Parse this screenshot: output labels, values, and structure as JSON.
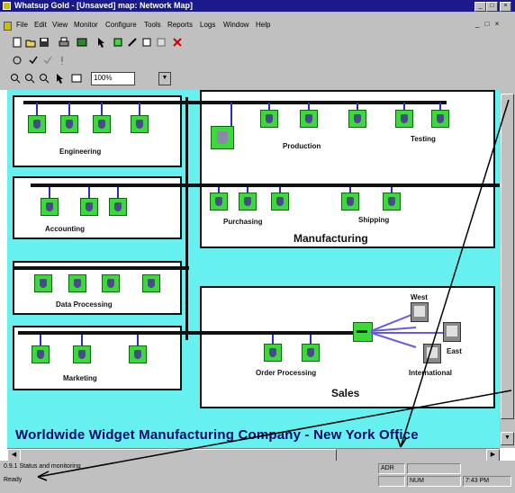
{
  "window": {
    "title": "Whatsup Gold - [Unsaved] map: Network Map]",
    "controls": [
      "_",
      "□",
      "×"
    ]
  },
  "menu": {
    "items": [
      "File",
      "Edit",
      "View",
      "Monitor",
      "Configure",
      "Tools",
      "Reports",
      "Logs",
      "Window",
      "Help"
    ],
    "mdi_controls": "_ □ ×"
  },
  "toolbar": {
    "zoom_value": "100%"
  },
  "map": {
    "departments": {
      "engineering": "Engineering",
      "accounting": "Accounting",
      "data_processing": "Data Processing",
      "marketing": "Marketing",
      "production": "Production",
      "testing": "Testing",
      "purchasing": "Purchasing",
      "shipping": "Shipping",
      "manufacturing": "Manufacturing",
      "order_processing": "Order Processing",
      "sales": "Sales",
      "west": "West",
      "east": "East",
      "international": "International"
    },
    "company_label": "Worldwide Widget Manufacturing Company - New York Office"
  },
  "status": {
    "message": "0.9.1 Status and monitoring",
    "ready": "Ready",
    "panel_top": "ADR",
    "num": "NUM",
    "time": "7:43 PM"
  },
  "colors": {
    "canvas": "#66f0f0",
    "node": "#3cd83c",
    "bus": "#111111",
    "link": "#2a2ad0",
    "titlebar": "#1a1a8c",
    "company_text": "#0a0a6a"
  }
}
